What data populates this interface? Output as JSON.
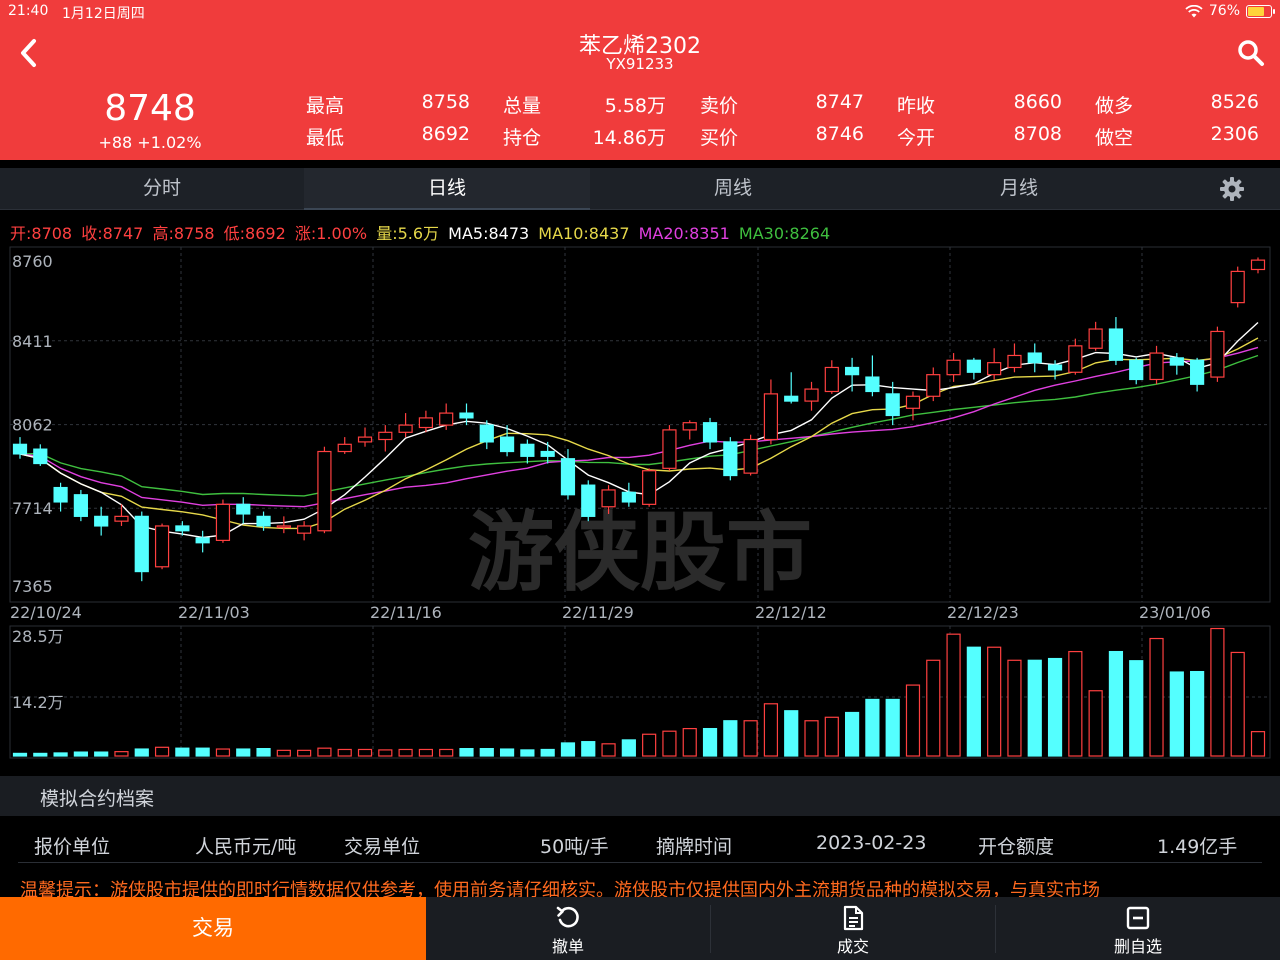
{
  "status": {
    "time": "21:40",
    "date": "1月12日周四",
    "battery": "76%",
    "battery_level": 0.76
  },
  "header": {
    "title": "苯乙烯2302",
    "code": "YX91233",
    "price": "8748",
    "change": "+88  +1.02%",
    "stats": [
      {
        "label": "最高",
        "value": "8758"
      },
      {
        "label": "总量",
        "value": "5.58万"
      },
      {
        "label": "卖价",
        "value": "8747"
      },
      {
        "label": "昨收",
        "value": "8660"
      },
      {
        "label": "做多",
        "value": "8526"
      },
      {
        "label": "最低",
        "value": "8692"
      },
      {
        "label": "持仓",
        "value": "14.86万"
      },
      {
        "label": "买价",
        "value": "8746"
      },
      {
        "label": "今开",
        "value": "8708"
      },
      {
        "label": "做空",
        "value": "2306"
      }
    ]
  },
  "tabs": [
    {
      "label": "分时"
    },
    {
      "label": "日线",
      "active": true
    },
    {
      "label": "周线"
    },
    {
      "label": "月线"
    }
  ],
  "indicators": {
    "open": "开:8708",
    "close": "收:8747",
    "high": "高:8758",
    "low": "低:8692",
    "pct": "涨:1.00%",
    "vol": "量:5.6万",
    "ma5": "MA5:8473",
    "ma10": "MA10:8437",
    "ma20": "MA20:8351",
    "ma30": "MA30:8264"
  },
  "chart_data": {
    "type": "candlestick",
    "watermark": "游侠股市",
    "price_ticks": [
      "8760",
      "8411",
      "8062",
      "7714",
      "7365"
    ],
    "ylim": [
      7365,
      8760
    ],
    "date_ticks": [
      "22/10/24",
      "22/11/03",
      "22/11/16",
      "22/11/29",
      "22/12/12",
      "22/12/23",
      "23/01/06"
    ],
    "volume_ticks": [
      "28.5万",
      "14.2万"
    ],
    "volume_max": 28.5,
    "ma_colors": {
      "ma5": "#ffffff",
      "ma10": "#e6d84a",
      "ma20": "#e040e0",
      "ma30": "#3fbf3f"
    },
    "candles": [
      [
        7980,
        7940,
        8010,
        7920,
        0.6
      ],
      [
        7960,
        7900,
        7980,
        7890,
        0.6
      ],
      [
        7800,
        7740,
        7820,
        7700,
        0.7
      ],
      [
        7770,
        7680,
        7790,
        7660,
        0.9
      ],
      [
        7680,
        7640,
        7720,
        7600,
        0.9
      ],
      [
        7660,
        7680,
        7730,
        7640,
        1.0
      ],
      [
        7680,
        7450,
        7700,
        7410,
        1.6
      ],
      [
        7470,
        7640,
        7650,
        7460,
        2.0
      ],
      [
        7640,
        7620,
        7660,
        7600,
        1.8
      ],
      [
        7590,
        7570,
        7620,
        7530,
        1.8
      ],
      [
        7580,
        7730,
        7750,
        7570,
        1.6
      ],
      [
        7730,
        7690,
        7760,
        7650,
        1.6
      ],
      [
        7680,
        7640,
        7700,
        7620,
        1.7
      ],
      [
        7640,
        7640,
        7680,
        7610,
        1.3
      ],
      [
        7610,
        7640,
        7660,
        7580,
        1.3
      ],
      [
        7620,
        7950,
        7970,
        7610,
        1.8
      ],
      [
        7950,
        7980,
        8010,
        7940,
        1.5
      ],
      [
        7990,
        8010,
        8050,
        7970,
        1.5
      ],
      [
        8000,
        8030,
        8060,
        7950,
        1.4
      ],
      [
        8030,
        8060,
        8110,
        8010,
        1.5
      ],
      [
        8050,
        8090,
        8120,
        8030,
        1.5
      ],
      [
        8060,
        8110,
        8150,
        8040,
        1.5
      ],
      [
        8110,
        8090,
        8150,
        8060,
        1.7
      ],
      [
        8060,
        7990,
        8080,
        7960,
        1.7
      ],
      [
        8010,
        7950,
        8060,
        7930,
        1.6
      ],
      [
        7980,
        7930,
        8000,
        7900,
        1.4
      ],
      [
        7950,
        7930,
        7990,
        7900,
        1.5
      ],
      [
        7920,
        7770,
        7960,
        7750,
        3.0
      ],
      [
        7810,
        7680,
        7830,
        7660,
        3.3
      ],
      [
        7720,
        7790,
        7810,
        7690,
        2.8
      ],
      [
        7780,
        7740,
        7820,
        7720,
        3.7
      ],
      [
        7730,
        7870,
        7880,
        7720,
        5.0
      ],
      [
        7880,
        8040,
        8060,
        7870,
        5.7
      ],
      [
        8040,
        8070,
        8080,
        8000,
        6.3
      ],
      [
        8070,
        7990,
        8090,
        7960,
        6.3
      ],
      [
        7990,
        7850,
        8010,
        7830,
        8.1
      ],
      [
        7860,
        8000,
        8020,
        7850,
        8.1
      ],
      [
        8000,
        8190,
        8250,
        7980,
        12.0
      ],
      [
        8180,
        8160,
        8280,
        8150,
        10.4
      ],
      [
        8160,
        8210,
        8240,
        8120,
        8.1
      ],
      [
        8200,
        8300,
        8330,
        8190,
        8.9
      ],
      [
        8300,
        8270,
        8340,
        8200,
        10.0
      ],
      [
        8260,
        8200,
        8350,
        8180,
        13.0
      ],
      [
        8190,
        8100,
        8240,
        8060,
        13.0
      ],
      [
        8130,
        8180,
        8200,
        8080,
        16.3
      ],
      [
        8180,
        8270,
        8300,
        8160,
        22.0
      ],
      [
        8270,
        8330,
        8360,
        8240,
        28.0
      ],
      [
        8330,
        8280,
        8340,
        8250,
        25.0
      ],
      [
        8270,
        8320,
        8380,
        8250,
        25.0
      ],
      [
        8300,
        8350,
        8400,
        8280,
        22.0
      ],
      [
        8360,
        8320,
        8400,
        8280,
        22.0
      ],
      [
        8310,
        8290,
        8330,
        8250,
        22.4
      ],
      [
        8280,
        8390,
        8420,
        8270,
        24.0
      ],
      [
        8380,
        8460,
        8490,
        8370,
        15.0
      ],
      [
        8460,
        8330,
        8510,
        8310,
        24.0
      ],
      [
        8330,
        8250,
        8340,
        8230,
        21.9
      ],
      [
        8250,
        8360,
        8390,
        8230,
        27.0
      ],
      [
        8340,
        8310,
        8360,
        8270,
        19.3
      ],
      [
        8330,
        8230,
        8340,
        8200,
        19.4
      ],
      [
        8260,
        8450,
        8470,
        8240,
        29.3
      ],
      [
        8570,
        8700,
        8720,
        8550,
        23.8
      ],
      [
        8708,
        8747,
        8758,
        8692,
        5.6
      ]
    ]
  },
  "archive": {
    "title": "模拟合约档案",
    "price_unit_label": "报价单位",
    "price_unit": "人民币元/吨",
    "trade_unit_label": "交易单位",
    "trade_unit": "50吨/手",
    "listing_label": "摘牌时间",
    "listing": "2023-02-23",
    "quota_label": "开仓额度",
    "quota": "1.49亿手"
  },
  "notice": "温馨提示：游侠股市提供的即时行情数据仅供参考，使用前务请仔细核实。游侠股市仅提供国内外主流期货品种的模拟交易，与真实市场",
  "bottom": {
    "trade": "交易",
    "cancel": "撤单",
    "deals": "成交",
    "remove": "删自选"
  }
}
